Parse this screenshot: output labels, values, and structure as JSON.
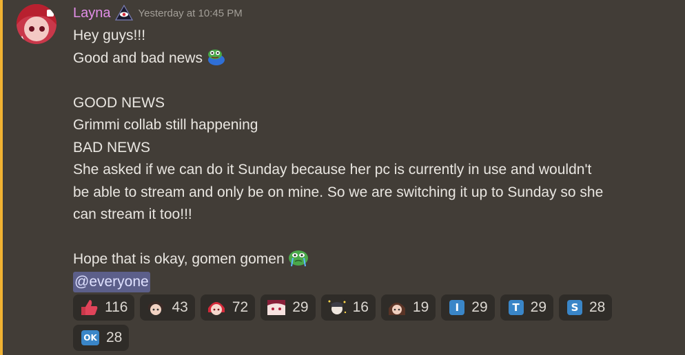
{
  "message": {
    "username": "Layna",
    "timestamp": "Yesterday at 10:45 PM",
    "role_icon": "pyramid-eye-icon",
    "lines": [
      "Hey guys!!!",
      "Good and bad news",
      "",
      "GOOD NEWS",
      "Grimmi collab still happening",
      "BAD NEWS",
      "She asked if we can do it Sunday because her pc is currently in use and wouldn't",
      "be able to stream and only be on mine. So we are switching it up to Sunday so she",
      "can stream it too!!!",
      "",
      "Hope that is okay, gomen gomen"
    ],
    "mention": "@everyone"
  },
  "reactions": [
    {
      "icon": "thumbs-up-emoji",
      "count": "116"
    },
    {
      "icon": "chibi-character-emoji",
      "count": "43"
    },
    {
      "icon": "red-hair-character-emoji",
      "count": "72"
    },
    {
      "icon": "anime-face-emoji",
      "count": "29"
    },
    {
      "icon": "sparkle-character-emoji",
      "count": "16"
    },
    {
      "icon": "brown-hair-character-emoji",
      "count": "19"
    },
    {
      "icon": "letter-i-emoji",
      "letter": "I",
      "count": "29"
    },
    {
      "icon": "letter-t-emoji",
      "letter": "T",
      "count": "29"
    },
    {
      "icon": "letter-s-emoji",
      "letter": "S",
      "count": "28"
    },
    {
      "icon": "ok-emoji",
      "letter": "OK",
      "count": "28"
    }
  ],
  "colors": {
    "background": "#423d37",
    "mention_bar": "#f0b232",
    "username": "#e28ee8",
    "mention_bg": "#5c5f8a",
    "reaction_bg": "#2f2c28"
  }
}
